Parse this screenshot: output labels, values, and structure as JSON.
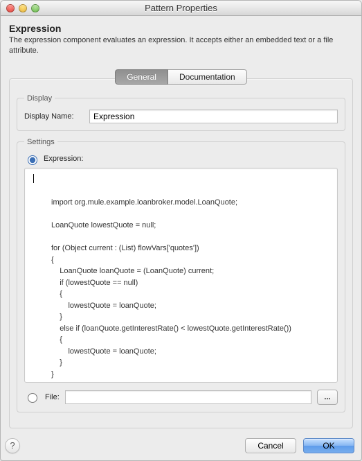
{
  "window": {
    "title": "Pattern Properties"
  },
  "header": {
    "heading": "Expression",
    "description": "The expression component evaluates an expression. It accepts either an embedded text or a file attribute."
  },
  "tabs": {
    "general": "General",
    "documentation": "Documentation"
  },
  "display": {
    "legend": "Display",
    "name_label": "Display Name:",
    "name_value": "Expression"
  },
  "settings": {
    "legend": "Settings",
    "expression_label": "Expression:",
    "expression_selected": true,
    "code": "\nimport org.mule.example.loanbroker.model.LoanQuote;\n\nLoanQuote lowestQuote = null;\n\nfor (Object current : (List) flowVars['quotes'])\n{\n    LoanQuote loanQuote = (LoanQuote) current;\n    if (lowestQuote == null)\n    {\n        lowestQuote = loanQuote;\n    }\n    else if (loanQuote.getInterestRate() < lowestQuote.getInterestRate())\n    {\n        lowestQuote = loanQuote;\n    }\n}\n\npayload = lowestQuote;",
    "file_label": "File:",
    "file_value": "",
    "browse_label": "..."
  },
  "footer": {
    "help_label": "?",
    "cancel": "Cancel",
    "ok": "OK"
  }
}
